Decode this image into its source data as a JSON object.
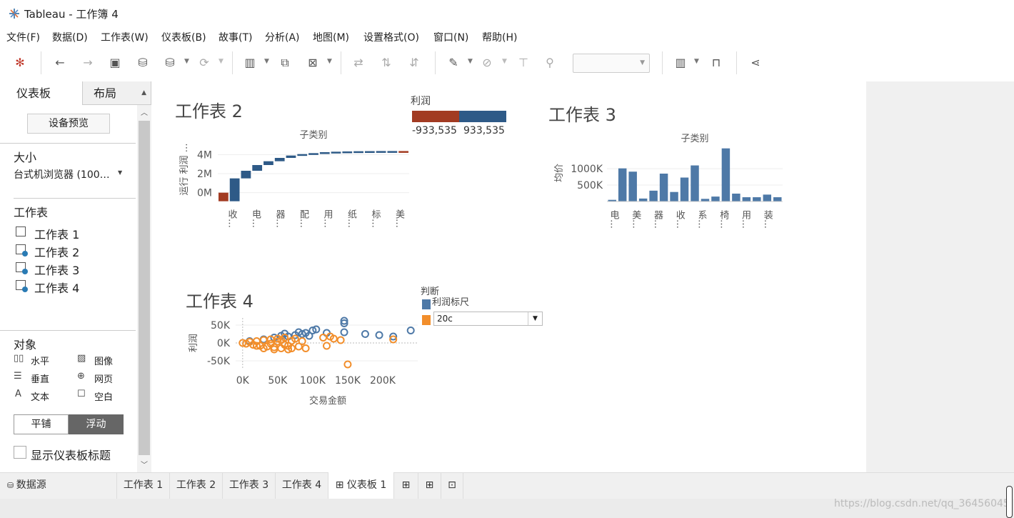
{
  "window": {
    "title": "Tableau - 工作簿 4"
  },
  "menu": [
    "文件(F)",
    "数据(D)",
    "工作表(W)",
    "仪表板(B)",
    "故事(T)",
    "分析(A)",
    "地图(M)",
    "设置格式(O)",
    "窗口(N)",
    "帮助(H)"
  ],
  "sidebar": {
    "tabs": [
      "仪表板",
      "布局"
    ],
    "device_preview": "设备预览",
    "size_heading": "大小",
    "size_value": "台式机浏览器 (100…",
    "sheets_heading": "工作表",
    "sheets": [
      "工作表 1",
      "工作表 2",
      "工作表 3",
      "工作表 4"
    ],
    "objects_heading": "对象",
    "objects": [
      {
        "icon": "horizontal-icon",
        "label": "水平"
      },
      {
        "icon": "image-icon",
        "label": "图像"
      },
      {
        "icon": "vertical-icon",
        "label": "垂直"
      },
      {
        "icon": "web-page-icon",
        "label": "网页"
      },
      {
        "icon": "text-icon",
        "label": "文本"
      },
      {
        "icon": "blank-icon",
        "label": "空白"
      }
    ],
    "tiled_label": "平铺",
    "floating_label": "浮动",
    "show_title_label": "显示仪表板标题"
  },
  "dashboard": {
    "sheet2": {
      "title": "工作表 2"
    },
    "sheet3": {
      "title": "工作表 3"
    },
    "sheet4": {
      "title": "工作表 4"
    },
    "profit_legend": {
      "title": "利润",
      "min_label": "-933,535",
      "max_label": "933,535",
      "neg_color": "#a23b22",
      "pos_color": "#2e5a87"
    },
    "judge_legend": {
      "title": "判断",
      "items": [
        {
          "label": "利润标尺",
          "color": "#4e79a7"
        },
        {
          "label": "",
          "color": "#f28e2b"
        }
      ]
    },
    "param_filter": {
      "value": "20c"
    }
  },
  "chart_data": [
    {
      "type": "bar",
      "subtype": "waterfall",
      "title": "子类别",
      "ylabel": "运行 利润 …",
      "y_ticks": [
        "4M",
        "2M",
        "0M"
      ],
      "categories": [
        "收…",
        "电…",
        "器…",
        "配…",
        "用…",
        "纸…",
        "标…",
        "美…"
      ],
      "values": [
        -0.9,
        1.5,
        2.3,
        2.9,
        3.3,
        3.65,
        3.9,
        4.05,
        4.15,
        4.25,
        4.3,
        4.33,
        4.35,
        4.36,
        4.37,
        4.37,
        4.25
      ],
      "ylim": [
        -1,
        5
      ]
    },
    {
      "type": "bar",
      "title": "子类别",
      "ylabel": "均价",
      "y_ticks": [
        "1000K",
        "500K"
      ],
      "categories": [
        "电…",
        "美…",
        "器…",
        "收…",
        "系…",
        "椅…",
        "用…",
        "装…"
      ],
      "values": [
        50,
        1010,
        910,
        90,
        330,
        850,
        290,
        730,
        1100,
        80,
        150,
        1620,
        240,
        130,
        130,
        210,
        130
      ],
      "ylim": [
        0,
        1700
      ]
    },
    {
      "type": "scatter",
      "xlabel": "交易金额",
      "ylabel": "利润",
      "x_ticks": [
        "0K",
        "50K",
        "100K",
        "150K",
        "200K"
      ],
      "y_ticks": [
        "50K",
        "0K",
        "-50K"
      ],
      "xlim": [
        -10000,
        250000
      ],
      "ylim": [
        -70000,
        70000
      ],
      "series": [
        {
          "name": "利润标尺",
          "color": "#4e79a7",
          "points": [
            [
              10000,
              5000
            ],
            [
              30000,
              10000
            ],
            [
              45000,
              15000
            ],
            [
              55000,
              20000
            ],
            [
              65000,
              18000
            ],
            [
              75000,
              22000
            ],
            [
              85000,
              25000
            ],
            [
              90000,
              28000
            ],
            [
              100000,
              35000
            ],
            [
              105000,
              38000
            ],
            [
              120000,
              28000
            ],
            [
              145000,
              30000
            ],
            [
              145000,
              55000
            ],
            [
              145000,
              62000
            ],
            [
              175000,
              25000
            ],
            [
              195000,
              22000
            ],
            [
              215000,
              18000
            ],
            [
              240000,
              35000
            ],
            [
              60000,
              26000
            ],
            [
              80000,
              30000
            ],
            [
              95000,
              20000
            ]
          ]
        },
        {
          "name": "",
          "color": "#f28e2b",
          "points": [
            [
              0,
              0
            ],
            [
              5000,
              -2000
            ],
            [
              10000,
              3000
            ],
            [
              15000,
              -5000
            ],
            [
              20000,
              5000
            ],
            [
              25000,
              -8000
            ],
            [
              30000,
              8000
            ],
            [
              35000,
              -10000
            ],
            [
              40000,
              10000
            ],
            [
              45000,
              -12000
            ],
            [
              50000,
              12000
            ],
            [
              55000,
              -15000
            ],
            [
              60000,
              15000
            ],
            [
              65000,
              -8000
            ],
            [
              70000,
              -15000
            ],
            [
              75000,
              12000
            ],
            [
              80000,
              -10000
            ],
            [
              85000,
              5000
            ],
            [
              90000,
              -15000
            ],
            [
              115000,
              15000
            ],
            [
              120000,
              -8000
            ],
            [
              125000,
              18000
            ],
            [
              130000,
              12000
            ],
            [
              140000,
              8000
            ],
            [
              150000,
              -60000
            ],
            [
              215000,
              10000
            ],
            [
              20000,
              -8000
            ],
            [
              30000,
              -15000
            ],
            [
              40000,
              -2000
            ],
            [
              50000,
              4000
            ],
            [
              60000,
              -5000
            ],
            [
              70000,
              6000
            ],
            [
              45000,
              -18000
            ],
            [
              55000,
              8000
            ],
            [
              65000,
              -18000
            ]
          ]
        }
      ]
    }
  ],
  "bottom_tabs": [
    "数据源",
    "工作表 1",
    "工作表 2",
    "工作表 3",
    "工作表 4",
    "仪表板 1"
  ],
  "watermark": "https://blog.csdn.net/qq_36456045"
}
